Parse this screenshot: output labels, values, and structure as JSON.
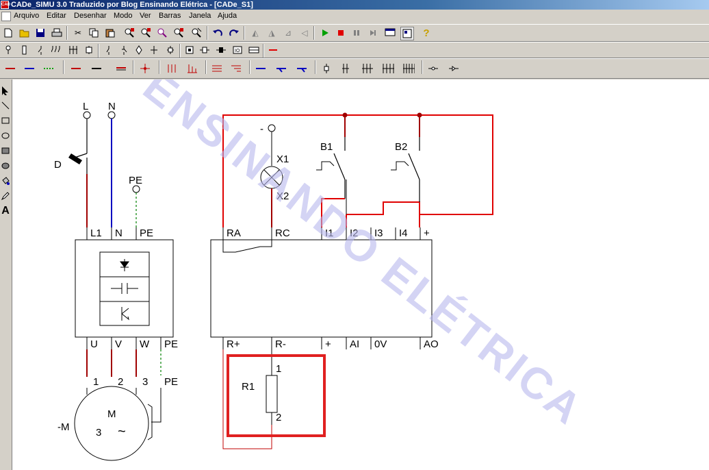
{
  "window": {
    "title": "CADe_SIMU 3.0 Traduzido por Blog Ensinando Elétrica - [CADe_S1]",
    "icon_text": "CAD"
  },
  "menu": [
    "Arquivo",
    "Editar",
    "Desenhar",
    "Modo",
    "Ver",
    "Barras",
    "Janela",
    "Ajuda"
  ],
  "toolbar1": {
    "file": [
      "new-icon",
      "open-icon",
      "save-icon",
      "print-icon"
    ],
    "edit": [
      "cut-icon",
      "copy-icon",
      "paste-icon",
      "zoom-icons"
    ],
    "undo": [
      "undo-icon",
      "redo-icon"
    ],
    "sim": [
      "run-icon",
      "stop-icon",
      "pause-icon",
      "step-icon",
      "window-icon",
      "grid-icon",
      "help-icon"
    ],
    "colors": {
      "run": "#00a000",
      "stop": "#e00000",
      "help": "#c8a000"
    }
  },
  "watermark": "ENSINANDO ELÉTRICA",
  "schematic": {
    "power": {
      "L": "L",
      "N": "N",
      "PE_top": "PE",
      "D": "D",
      "in": [
        "L1",
        "N",
        "PE"
      ],
      "out": [
        "U",
        "V",
        "W",
        "PE"
      ],
      "motor_terms": [
        "1",
        "2",
        "3",
        "PE"
      ],
      "motor_label": "-M",
      "motor_M": "M",
      "motor_3": "3",
      "motor_ac": "~"
    },
    "controller": {
      "minus": "-",
      "x1": "X1",
      "x2": "X2",
      "b1": "B1",
      "b2": "B2",
      "top": [
        "RA",
        "RC",
        "I1",
        "I2",
        "I3",
        "I4",
        "+"
      ],
      "bottom": [
        "R+",
        "R-",
        "+",
        "AI",
        "0V",
        "AO"
      ],
      "r1": "R1",
      "r1_pin1": "1",
      "r1_pin2": "2"
    }
  }
}
